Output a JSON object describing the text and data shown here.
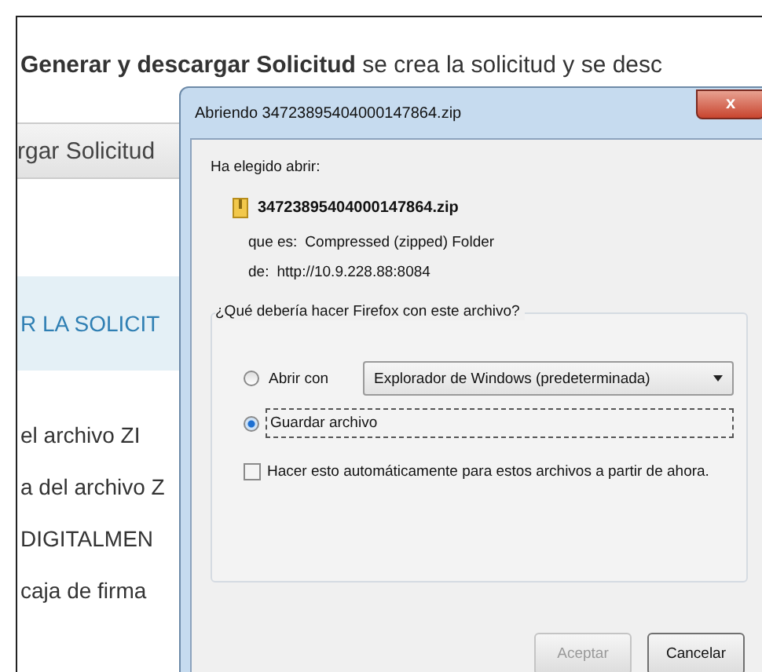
{
  "page": {
    "heading": "**Generar y descargar Solicitud** se crea la solicitud y se desc",
    "tab_label": "rgar Solicitud",
    "section_title": "R LA SOLICIT",
    "lines": [
      "el archivo ZI",
      "a del archivo Z",
      "DIGITALMEN",
      "caja de firma"
    ]
  },
  "dialog": {
    "title": "Abriendo 34723895404000147864.zip",
    "close": "x",
    "intro": "Ha elegido abrir:",
    "file_name": "34723895404000147864.zip",
    "type_label": "que es:",
    "type_value": "Compressed (zipped) Folder",
    "from_label": "de:",
    "from_value": "http://10.9.228.88:8084",
    "question": "¿Qué debería hacer Firefox con este archivo?",
    "options": [
      {
        "kind": "open",
        "label": "Abrir con",
        "selected": false,
        "app": "Explorador de Windows (predeterminada)"
      },
      {
        "kind": "save",
        "label": "Guardar archivo",
        "selected": true
      }
    ],
    "auto": {
      "label": "Hacer esto automáticamente para estos archivos a partir de ahora.",
      "checked": false
    },
    "buttons": [
      {
        "label": "Aceptar",
        "disabled": true
      },
      {
        "label": "Cancelar",
        "disabled": false
      }
    ]
  }
}
